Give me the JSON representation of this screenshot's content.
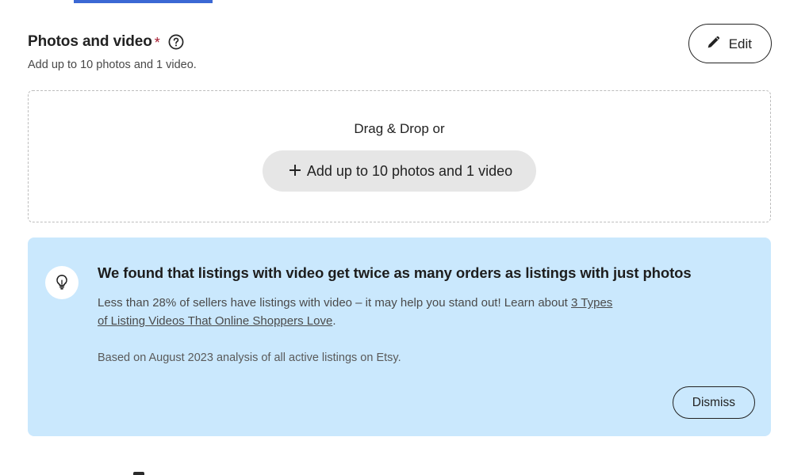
{
  "top_indicator": {
    "name": "active-tab-underline",
    "color": "#3b68d4"
  },
  "section": {
    "title": "Photos and video",
    "required_marker": "*",
    "help_icon": "question-circle-icon",
    "subtitle": "Add up to 10 photos and 1 video.",
    "edit_button": {
      "label": "Edit",
      "icon": "pencil-icon"
    }
  },
  "dropzone": {
    "label": "Drag & Drop or",
    "add_button": {
      "label": "Add up to 10 photos and 1 video",
      "icon": "plus-icon",
      "background": "#e6e6e6"
    },
    "border_style": "dashed",
    "border_color": "#bdbdbd"
  },
  "banner": {
    "icon": "lightbulb-icon",
    "background": "#cae8fd",
    "title": "We found that listings with video get twice as many orders as listings with just photos",
    "text_before_link": "Less than 28% of sellers have listings with video – it may help you stand out! Learn about ",
    "link_text": "3 Types of Listing Videos That Online Shoppers Love",
    "text_after_link": ".",
    "note": "Based on August 2023 analysis of all active listings on Etsy.",
    "dismiss_button": {
      "label": "Dismiss"
    }
  }
}
